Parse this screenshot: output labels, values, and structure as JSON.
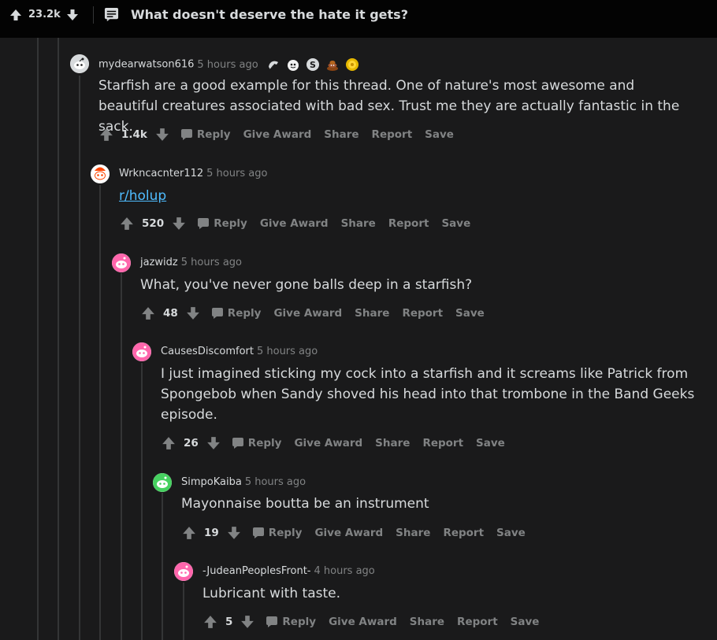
{
  "post": {
    "score": "23.2k",
    "title": "What doesn't deserve the hate it gets?"
  },
  "actions": {
    "reply": "Reply",
    "give_award": "Give Award",
    "share": "Share",
    "report": "Report",
    "save": "Save"
  },
  "comments": [
    {
      "author": "mydearwatson616",
      "time": "5 hours ago",
      "awards": [
        "award-1-icon",
        "award-2-icon",
        "award-3-icon",
        "award-4-icon",
        "award-5-icon"
      ],
      "body": "Starfish are a good example for this thread. One of nature's most awesome and beautiful creatures associated with bad sex. Trust me they are actually fantastic in the sack.",
      "score": "1.4k",
      "avatar_color": "#e8e8e8"
    },
    {
      "author": "Wrkncacnter112",
      "time": "5 hours ago",
      "body_link": "r/holup",
      "score": "520",
      "avatar_color": "#ff4500"
    },
    {
      "author": "jazwidz",
      "time": "5 hours ago",
      "body": "What, you've never gone balls deep in a starfish?",
      "score": "48",
      "avatar_color": "#ff66ac"
    },
    {
      "author": "CausesDiscomfort",
      "time": "5 hours ago",
      "body": "I just imagined sticking my cock into a starfish and it screams like Patrick from Spongebob when Sandy shoved his head into that trombone in the Band Geeks episode.",
      "score": "26",
      "avatar_color": "#ff66ac"
    },
    {
      "author": "SimpoKaiba",
      "time": "5 hours ago",
      "body": "Mayonnaise boutta be an instrument",
      "score": "19",
      "avatar_color": "#46d160"
    },
    {
      "author": "-JudeanPeoplesFront-",
      "time": "4 hours ago",
      "body": "Lubricant with taste.",
      "score": "5",
      "avatar_color": "#ff66ac"
    }
  ]
}
